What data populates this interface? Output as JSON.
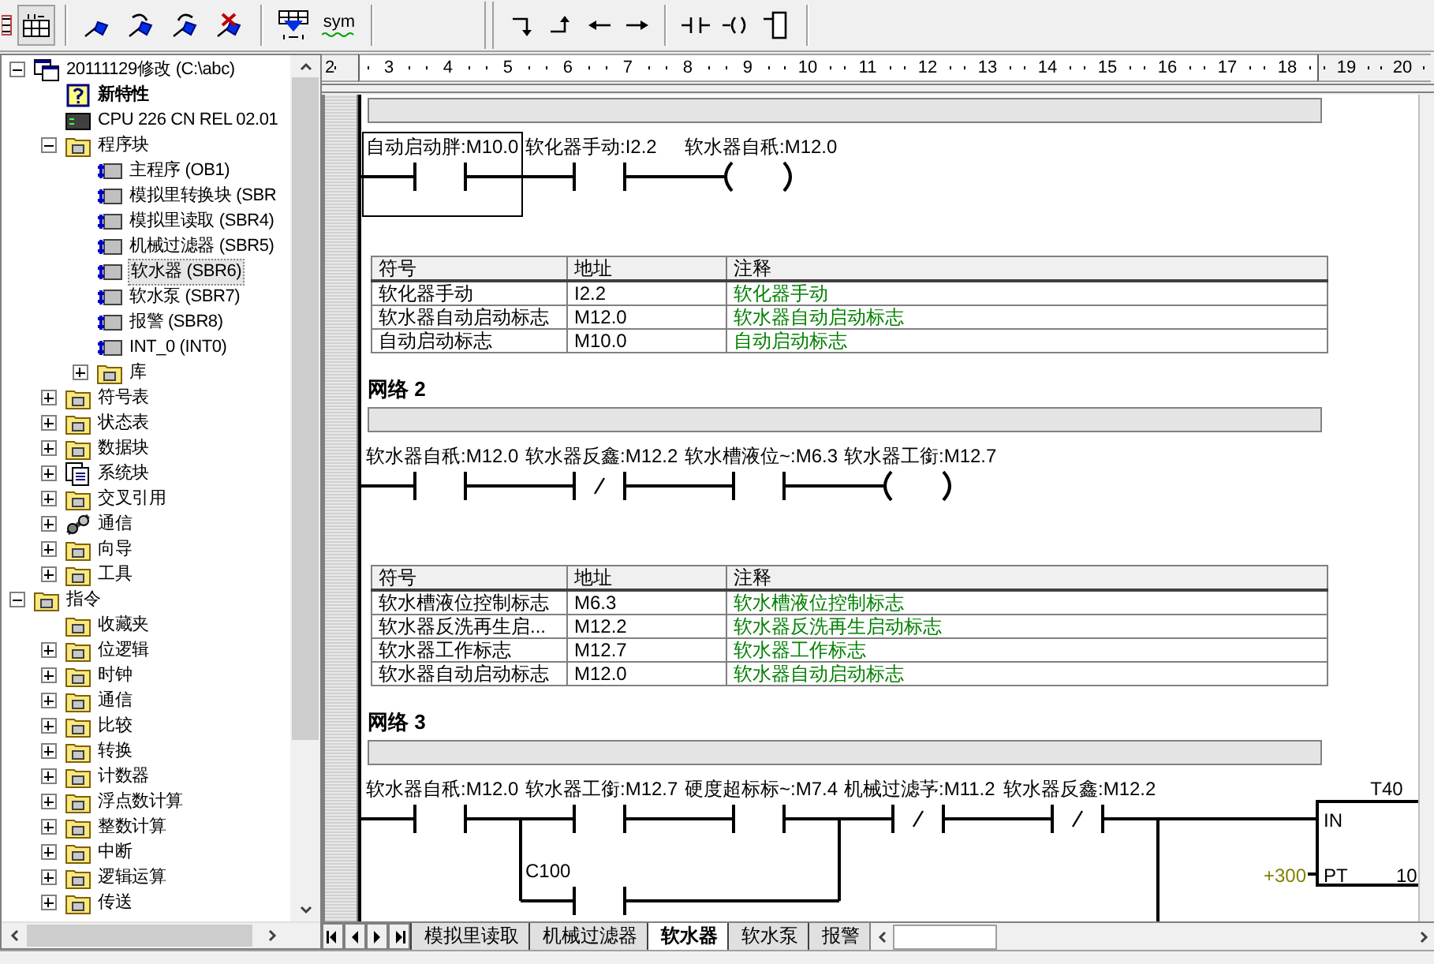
{
  "toolbar": {
    "symbol_button": {
      "label": "sym"
    }
  },
  "tree": [
    {
      "label": "20111129修改 (C:\\abc)",
      "kind": "project",
      "expanded": true,
      "selected": false,
      "children": [
        {
          "label": "新特性",
          "kind": "help",
          "selected": false
        },
        {
          "label": "CPU 226 CN REL 02.01",
          "kind": "cpu",
          "selected": false
        },
        {
          "label": "程序块",
          "kind": "folder",
          "expanded": true,
          "selected": false,
          "children": [
            {
              "label": "主程序 (OB1)",
              "kind": "block",
              "selected": false
            },
            {
              "label": "模拟里转换块 (SBR",
              "kind": "block",
              "selected": false
            },
            {
              "label": "模拟里读取 (SBR4)",
              "kind": "block",
              "selected": false
            },
            {
              "label": "机械过滤器 (SBR5)",
              "kind": "block",
              "selected": false
            },
            {
              "label": "软水器 (SBR6)",
              "kind": "block",
              "selected": true
            },
            {
              "label": "软水泵 (SBR7)",
              "kind": "block",
              "selected": false
            },
            {
              "label": "报警 (SBR8)",
              "kind": "block",
              "selected": false
            },
            {
              "label": "INT_0 (INT0)",
              "kind": "block",
              "selected": false
            },
            {
              "label": "库",
              "kind": "folder",
              "expanded": false,
              "selected": false
            }
          ]
        },
        {
          "label": "符号表",
          "kind": "folder",
          "expanded": false,
          "selected": false
        },
        {
          "label": "状态表",
          "kind": "folder",
          "expanded": false,
          "selected": false
        },
        {
          "label": "数据块",
          "kind": "folder",
          "expanded": false,
          "selected": false
        },
        {
          "label": "系统块",
          "kind": "system",
          "expanded": false,
          "selected": false
        },
        {
          "label": "交叉引用",
          "kind": "folder",
          "expanded": false,
          "selected": false
        },
        {
          "label": "通信",
          "kind": "comm",
          "expanded": false,
          "selected": false
        },
        {
          "label": "向导",
          "kind": "folder",
          "expanded": false,
          "selected": false
        },
        {
          "label": "工具",
          "kind": "folder",
          "expanded": false,
          "selected": false
        }
      ]
    },
    {
      "label": "指令",
      "kind": "folder",
      "expanded": true,
      "selected": false,
      "children": [
        {
          "label": "收藏夹",
          "kind": "folder",
          "selected": false
        },
        {
          "label": "位逻辑",
          "kind": "folder",
          "expanded": false,
          "selected": false
        },
        {
          "label": "时钟",
          "kind": "folder",
          "expanded": false,
          "selected": false
        },
        {
          "label": "通信",
          "kind": "folder",
          "expanded": false,
          "selected": false
        },
        {
          "label": "比较",
          "kind": "folder",
          "expanded": false,
          "selected": false
        },
        {
          "label": "转换",
          "kind": "folder",
          "expanded": false,
          "selected": false
        },
        {
          "label": "计数器",
          "kind": "folder",
          "expanded": false,
          "selected": false
        },
        {
          "label": "浮点数计算",
          "kind": "folder",
          "expanded": false,
          "selected": false
        },
        {
          "label": "整数计算",
          "kind": "folder",
          "expanded": false,
          "selected": false
        },
        {
          "label": "中断",
          "kind": "folder",
          "expanded": false,
          "selected": false
        },
        {
          "label": "逻辑运算",
          "kind": "folder",
          "expanded": false,
          "selected": false
        },
        {
          "label": "传送",
          "kind": "folder",
          "expanded": false,
          "selected": false
        }
      ]
    }
  ],
  "ruler": {
    "marks": [
      {
        "label": "2",
        "in_range": false
      },
      {
        "label": "3",
        "in_range": true
      },
      {
        "label": "4",
        "in_range": true
      },
      {
        "label": "5",
        "in_range": true
      },
      {
        "label": "6",
        "in_range": true
      },
      {
        "label": "7",
        "in_range": true
      },
      {
        "label": "8",
        "in_range": true
      },
      {
        "label": "9",
        "in_range": true
      },
      {
        "label": "10",
        "in_range": true
      },
      {
        "label": "11",
        "in_range": true
      },
      {
        "label": "12",
        "in_range": true
      },
      {
        "label": "13",
        "in_range": true
      },
      {
        "label": "14",
        "in_range": true
      },
      {
        "label": "15",
        "in_range": true
      },
      {
        "label": "16",
        "in_range": true
      },
      {
        "label": "17",
        "in_range": true
      },
      {
        "label": "18",
        "in_range": true
      },
      {
        "label": "19",
        "in_range": false
      },
      {
        "label": "20",
        "in_range": false
      }
    ]
  },
  "networks": [
    {
      "rung": [
        {
          "kind": "contact_no",
          "operand": "自动启动胖:M10.0",
          "selected": true
        },
        {
          "kind": "contact_no",
          "operand": "软化器手动:I2.2",
          "selected": false
        },
        {
          "kind": "coil",
          "operand": "软水器自秖:M12.0",
          "selected": false
        }
      ],
      "symbols": {
        "columns": [
          "符号",
          "地址",
          "注释"
        ],
        "rows": [
          {
            "symbol": "软化器手动",
            "address": "I2.2",
            "comment": "软化器手动"
          },
          {
            "symbol": "软水器自动启动标志",
            "address": "M12.0",
            "comment": "软水器自动启动标志"
          },
          {
            "symbol": "自动启动标志",
            "address": "M10.0",
            "comment": "自动启动标志"
          }
        ]
      }
    },
    {
      "title": "网络 2",
      "rung": [
        {
          "kind": "contact_no",
          "operand": "软水器自秖:M12.0",
          "selected": false
        },
        {
          "kind": "contact_nc",
          "operand": "软水器反鑫:M12.2",
          "selected": false
        },
        {
          "kind": "contact_no",
          "operand": "软水槽液位~:M6.3",
          "selected": false
        },
        {
          "kind": "coil",
          "operand": "软水器工銜:M12.7",
          "selected": false
        }
      ],
      "symbols": {
        "columns": [
          "符号",
          "地址",
          "注释"
        ],
        "rows": [
          {
            "symbol": "软水槽液位控制标志",
            "address": "M6.3",
            "comment": "软水槽液位控制标志"
          },
          {
            "symbol": "软水器反洗再生启...",
            "address": "M12.2",
            "comment": "软水器反洗再生启动标志"
          },
          {
            "symbol": "软水器工作标志",
            "address": "M12.7",
            "comment": "软水器工作标志"
          },
          {
            "symbol": "软水器自动启动标志",
            "address": "M12.0",
            "comment": "软水器自动启动标志"
          }
        ]
      }
    },
    {
      "title": "网络 3",
      "rung": [
        {
          "kind": "contact_no",
          "operand": "软水器自秖:M12.0",
          "selected": false
        },
        {
          "kind": "branch",
          "paths": [
            [
              {
                "kind": "contact_no",
                "operand": "软水器工銜:M12.7",
                "selected": false
              },
              {
                "kind": "contact_no",
                "operand": "硬度超标标~:M7.4",
                "selected": false
              }
            ],
            [
              {
                "kind": "contact_no",
                "operand": "C100",
                "selected": false
              }
            ]
          ]
        },
        {
          "kind": "contact_nc",
          "operand": "机械过滤芧:M11.2",
          "selected": false
        },
        {
          "kind": "contact_nc",
          "operand": "软水器反鑫:M12.2",
          "selected": false
        },
        {
          "kind": "wire_down"
        },
        {
          "kind": "timer",
          "operand": "T40",
          "selected": false,
          "pins": [
            {
              "name": "IN"
            },
            {
              "name": "PT",
              "value": "+300"
            }
          ],
          "pt_right_text": "10"
        }
      ]
    }
  ],
  "sheet_tabs": [
    {
      "label": "模拟里读取",
      "selected": false
    },
    {
      "label": "机械过滤器",
      "selected": false
    },
    {
      "label": "软水器",
      "selected": true
    },
    {
      "label": "软水泵",
      "selected": false
    },
    {
      "label": "报警",
      "selected": false
    }
  ]
}
